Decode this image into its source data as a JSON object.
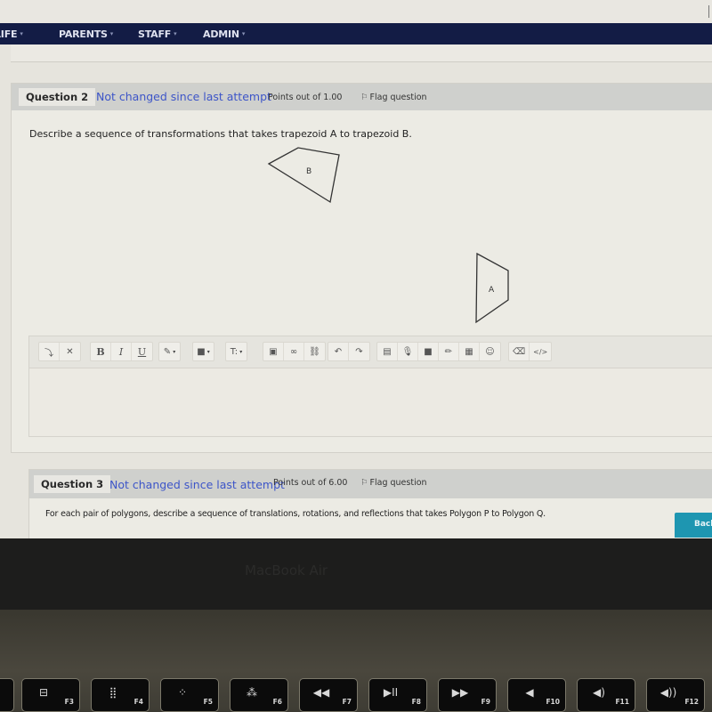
{
  "nav": {
    "items": [
      {
        "label": "LIFE",
        "caret": "▾"
      },
      {
        "label": "PARENTS",
        "caret": "▾"
      },
      {
        "label": "STAFF",
        "caret": "▾"
      },
      {
        "label": "ADMIN",
        "caret": "▾"
      }
    ]
  },
  "question2": {
    "number": "Question 2",
    "status": "Not changed since last attempt",
    "points": "Points out of 1.00",
    "flag_label": "Flag question",
    "text": "Describe a sequence of transformations that takes trapezoid A to trapezoid B.",
    "shapes": [
      {
        "label": "B"
      },
      {
        "label": "A"
      }
    ]
  },
  "editor": {
    "toolbar_groups": [
      [
        {
          "icon": "collapse-icon",
          "glyph": "⤵"
        },
        {
          "icon": "fullscreen-icon",
          "glyph": "✕"
        }
      ],
      [
        {
          "icon": "bold-icon",
          "glyph": "B"
        },
        {
          "icon": "italic-icon",
          "glyph": "I"
        },
        {
          "icon": "underline-icon",
          "glyph": "U"
        }
      ],
      [
        {
          "icon": "edit-style-icon",
          "glyph": "✎",
          "dropdown": "▾"
        }
      ],
      [
        {
          "icon": "highlight-icon",
          "glyph": "■",
          "dropdown": "▾"
        }
      ],
      [
        {
          "icon": "text-size-icon",
          "glyph": "T:",
          "dropdown": "▾"
        }
      ],
      [
        {
          "icon": "image-icon",
          "glyph": "▣"
        },
        {
          "icon": "link-icon",
          "glyph": "∞"
        },
        {
          "icon": "unlink-icon",
          "glyph": "⛓"
        }
      ],
      [
        {
          "icon": "undo-icon",
          "glyph": "↶"
        },
        {
          "icon": "redo-icon",
          "glyph": "↷"
        }
      ],
      [
        {
          "icon": "media-icon",
          "glyph": "▤"
        },
        {
          "icon": "microphone-icon",
          "glyph": "🎙"
        },
        {
          "icon": "video-icon",
          "glyph": "■"
        },
        {
          "icon": "pencil-icon",
          "glyph": "✏"
        },
        {
          "icon": "table-icon",
          "glyph": "▦"
        },
        {
          "icon": "emoji-icon",
          "glyph": "☺"
        }
      ],
      [
        {
          "icon": "eraser-icon",
          "glyph": "⌫"
        },
        {
          "icon": "html-icon",
          "glyph": "</>"
        }
      ]
    ],
    "content": ""
  },
  "question3": {
    "number": "Question 3",
    "status": "Not changed since last attempt",
    "points": "Points out of 6.00",
    "flag_label": "Flag question",
    "text": "For each pair of polygons, describe a sequence of translations, rotations, and reflections that takes Polygon P to Polygon Q."
  },
  "back_button": {
    "label": "Back"
  },
  "device": {
    "label": "MacBook Air",
    "fkeys": [
      {
        "label": "F3",
        "glyph": "⊟"
      },
      {
        "label": "F4",
        "glyph": "⣿"
      },
      {
        "label": "F5",
        "glyph": "⁘"
      },
      {
        "label": "F6",
        "glyph": "⁂"
      },
      {
        "label": "F7",
        "glyph": "◀◀"
      },
      {
        "label": "F8",
        "glyph": "▶II"
      },
      {
        "label": "F9",
        "glyph": "▶▶"
      },
      {
        "label": "F10",
        "glyph": "◀"
      },
      {
        "label": "F11",
        "glyph": "◀)"
      },
      {
        "label": "F12",
        "glyph": "◀))"
      }
    ]
  }
}
